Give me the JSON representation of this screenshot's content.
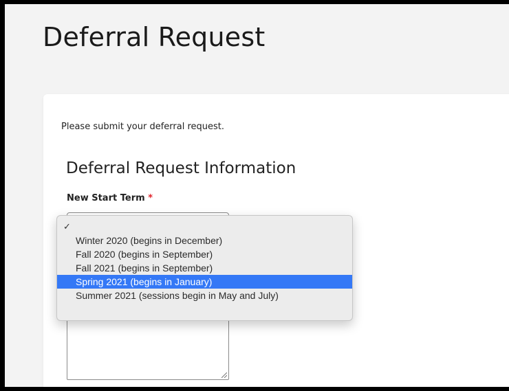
{
  "page": {
    "title": "Deferral Request"
  },
  "form": {
    "intro": "Please submit your deferral request.",
    "section_heading": "Deferral Request Information",
    "start_term_label": "New Start Term",
    "required_marker": "*"
  },
  "dropdown": {
    "selected_index": 0,
    "highlighted_index": 4,
    "options": [
      "",
      "Winter 2020 (begins in December)",
      "Fall 2020 (begins in September)",
      "Fall 2021 (begins in September)",
      "Spring 2021 (begins in January)",
      "Summer 2021 (sessions begin in May and July)"
    ],
    "icons": {
      "checked": "checkmark-icon"
    }
  },
  "colors": {
    "highlight": "#3478f6",
    "required": "#e0242c",
    "background": "#f3f3f3"
  }
}
